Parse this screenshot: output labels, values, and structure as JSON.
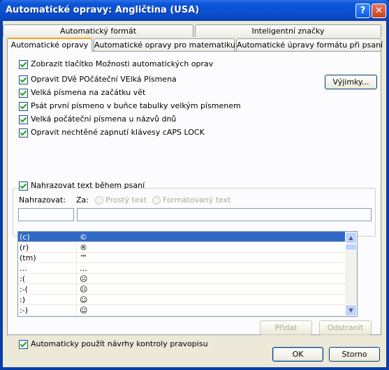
{
  "window": {
    "title": "Automatické opravy: Angličtina (USA)",
    "help_label": "?",
    "close_label": "✕"
  },
  "tabs": {
    "row1": [
      "Automatický formát",
      "Inteligentní značky"
    ],
    "row2": [
      "Automatické opravy",
      "Automatické opravy pro matematiku",
      "Automatické úpravy formátu při psaní"
    ]
  },
  "options": {
    "show_buttons": "Zobrazit tlačítko Možnosti automatických oprav",
    "two_initial_caps": "Opravit DVě POčáteční VElká Písmena",
    "capitalize_sentences": "Velká písmena na začátku vět",
    "capitalize_table_cells": "Psát první písmeno v buňce tabulky velkým písmenem",
    "capitalize_days": "Velká počáteční písmena u názvů dnů",
    "caps_lock": "Opravit nechtěné zapnutí klávesy cAPS LOCK",
    "exceptions_button": "Výjimky...",
    "replace_text": "Nahrazovat text během psaní",
    "replace_label": "Nahrazovat:",
    "with_label": "Za:",
    "plain_text": "Prostý text",
    "formatted_text": "Formátovaný text",
    "add_button": "Přidat",
    "delete_button": "Odstranit",
    "use_suggestions": "Automaticky použít návrhy kontroly pravopisu"
  },
  "entries": [
    {
      "replace": "(c)",
      "with": "©"
    },
    {
      "replace": "(r)",
      "with": "®"
    },
    {
      "replace": "(tm)",
      "with": "™"
    },
    {
      "replace": "...",
      "with": "…"
    },
    {
      "replace": ":(",
      "with": "☹"
    },
    {
      "replace": ":-(",
      "with": "☹"
    },
    {
      "replace": ":)",
      "with": "☺"
    },
    {
      "replace": ":-)",
      "with": "☺"
    }
  ],
  "footer": {
    "ok": "OK",
    "cancel": "Storno"
  }
}
